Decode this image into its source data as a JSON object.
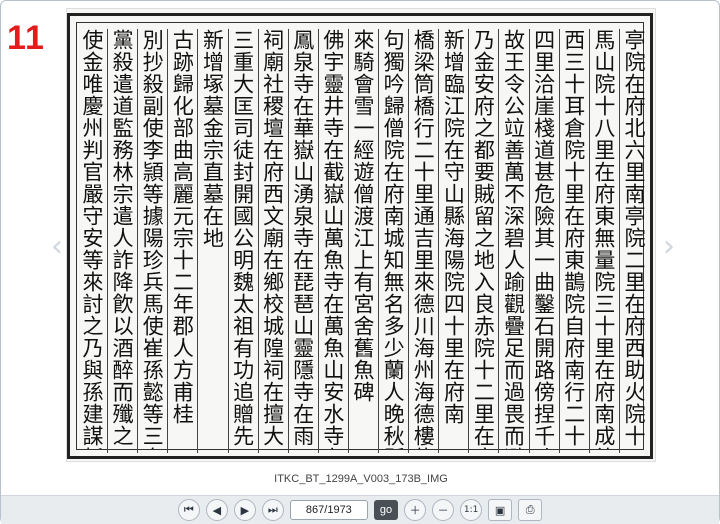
{
  "page_badge": "11",
  "image_caption": "ITKC_BT_1299A_V003_173B_IMG",
  "toolbar": {
    "first_icon": "skip-first-icon",
    "prev_icon": "prev-icon",
    "next_icon": "next-icon",
    "last_icon": "skip-last-icon",
    "page_value": "867/1973",
    "go_label": "go",
    "zoom_in_icon": "zoom-in-icon",
    "zoom_out_icon": "zoom-out-icon",
    "actual_size_label": "1:1",
    "fit_icon": "fit-image-icon",
    "print_icon": "print-icon"
  },
  "nav": {
    "left_arrow": "‹",
    "right_arrow": "›"
  },
  "document": {
    "columns": [
      "亭院在府北六里南亭院二里在府西助火院十三里在府南",
      "馬山院十八里在府東無量院三十里在府南成德院在府",
      "西三十耳倉院十里在府東鵲院自府南行二十五六里在府",
      "四里洽崖棧道甚危險其一曲鑿石開路傍捏千丈之淵",
      "故王令公竝善萬不深碧人踰觀疊足而過畏而避之",
      "乃金安府之都要賊留之地入良赤院十二里在府南三里",
      "新增臨江院在守山縣海陽院四十里在府南",
      "橋梁筒橋行二十里通吉里來德川海州海德樓龍驚",
      "句獨吟歸僧院在府南城知無名多少蘭人晚秋縣參緣寺詩",
      "來騎會雪一經遊僧渡江上有宮舍舊魚碑",
      "佛宇靈井寺在截嶽山萬魚寺在萬魚山安水寺在鶴",
      "鳳泉寺在華嶽山湧泉寺在琵琶山靈隱寺在雨",
      "祠廟社稷壇在府西文廟在鄉校城隍祠在擅大",
      "三重大匡司徒封開國公明魏太祖有功追贈先尹柯在帝",
      "新增塚墓金宗直墓在地",
      "古跡歸化部曲高麗元宗十二年郡人方甫桂",
      "別抄殺副使李頴等據陽珍兵馬使崔孫懿等三島一年",
      "黨殺遣道監務林宗遣人詐降飮以酒醉而殲之",
      "使金唯慶州判官嚴守安等來討之乃與孫建謀斬"
    ]
  }
}
